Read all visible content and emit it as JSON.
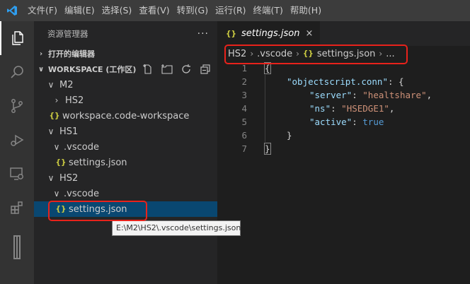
{
  "menu": [
    "文件(F)",
    "编辑(E)",
    "选择(S)",
    "查看(V)",
    "转到(G)",
    "运行(R)",
    "终端(T)",
    "帮助(H)"
  ],
  "sidebar": {
    "title": "资源管理器",
    "more": "···",
    "open_editors": "打开的编辑器",
    "workspace": "WORKSPACE (工作区)",
    "tree": [
      {
        "label": "M2",
        "chev": "∨"
      },
      {
        "label": "HS2",
        "chev": "›"
      },
      {
        "label": "workspace.code-workspace",
        "icon": "{}"
      },
      {
        "label": "HS1",
        "chev": "∨"
      },
      {
        "label": ".vscode",
        "chev": "∨"
      },
      {
        "label": "settings.json",
        "icon": "{}"
      },
      {
        "label": "HS2",
        "chev": "∨"
      },
      {
        "label": ".vscode",
        "chev": "∨"
      },
      {
        "label": "settings.json",
        "icon": "{}"
      }
    ]
  },
  "tooltip": "E:\\M2\\HS2\\.vscode\\settings.json",
  "tab": {
    "label": "settings.json",
    "icon": "{}",
    "close": "×"
  },
  "breadcrumb": {
    "seg1": "HS2",
    "seg2": ".vscode",
    "seg3": "settings.json",
    "seg4": "..."
  },
  "code": {
    "line_numbers": [
      "1",
      "2",
      "3",
      "4",
      "5",
      "6",
      "7"
    ],
    "l1": "{",
    "l2_key": "\"objectscript.conn\"",
    "l2_rest": ": {",
    "l3_key": "\"server\"",
    "l3_val": "\"healtshare\"",
    "l4_key": "\"ns\"",
    "l4_val": "\"HSEDGE1\"",
    "l5_key": "\"active\"",
    "l5_val": "true",
    "l6": "}",
    "l7": "}"
  },
  "colors": {
    "accent": "#007acc",
    "selection": "#094771",
    "highlight_box": "#e8221b",
    "json_icon": "#cbcb41"
  }
}
